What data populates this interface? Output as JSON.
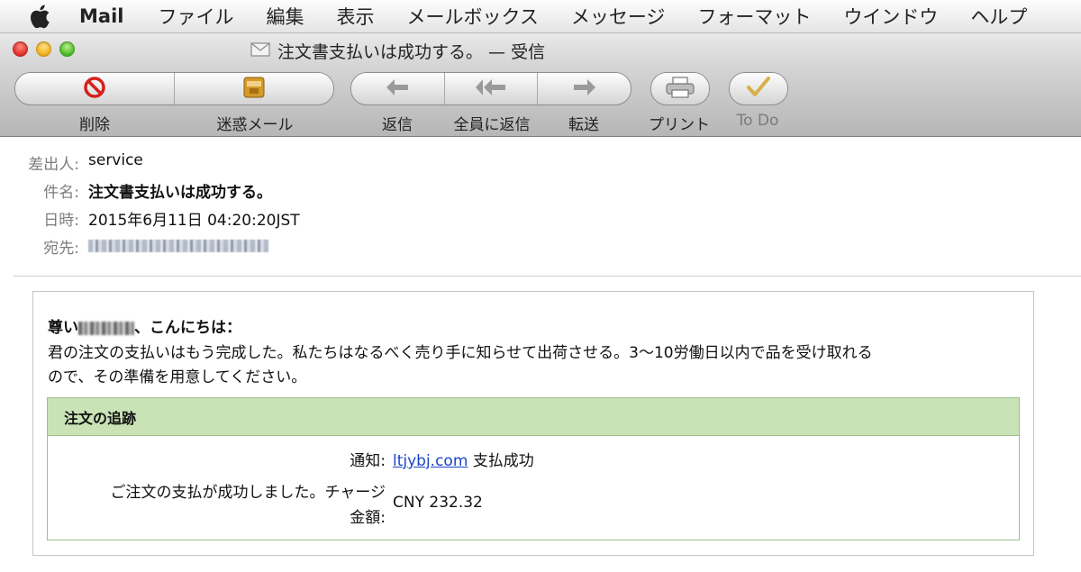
{
  "menubar": {
    "app": "Mail",
    "items": [
      "ファイル",
      "編集",
      "表示",
      "メールボックス",
      "メッセージ",
      "フォーマット",
      "ウインドウ",
      "ヘルプ"
    ]
  },
  "window": {
    "title": "注文書支払いは成功する。 — 受信"
  },
  "toolbar": {
    "delete": "削除",
    "junk": "迷惑メール",
    "reply": "返信",
    "reply_all": "全員に返信",
    "forward": "転送",
    "print": "プリント",
    "todo": "To Do"
  },
  "header": {
    "from_label": "差出人:",
    "from": "service",
    "subject_label": "件名:",
    "subject": "注文書支払いは成功する。",
    "date_label": "日時:",
    "date": "2015年6月11日 04:20:20JST",
    "to_label": "宛先:"
  },
  "message": {
    "greeting_prefix": "尊い",
    "greeting_suffix": "、こんにちは：",
    "line1": "君の注文の支払いはもう完成した。私たちはなるべく売り手に知らせて出荷させる。3〜10労働日以内で品を受け取れる",
    "line2": "ので、その準備を用意してください。",
    "order": {
      "heading": "注文の追跡",
      "notice_label": "通知:",
      "notice_link": "ltjybj.com",
      "notice_text": "支払成功",
      "charge_label_1": "ご注文の支払が成功しました。チャージ",
      "charge_label_2": "金額:",
      "charge_value": "CNY 232.32"
    }
  },
  "colors": {
    "order_header": "#c9e3b7",
    "order_border": "#9cc088",
    "link": "#1a45c9",
    "label_gray": "#7d7d7d"
  }
}
